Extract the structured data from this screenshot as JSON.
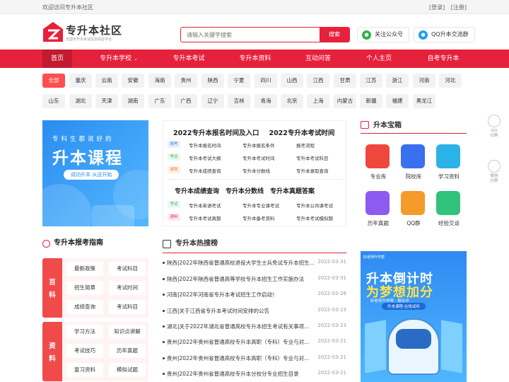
{
  "topbar": {
    "welcome": "欢迎访问专升本社区",
    "login": "[登录]",
    "register": "[注册]"
  },
  "logo": {
    "name": "专升本社区",
    "tagline": "全国专升本考试信息综合平台"
  },
  "search": {
    "placeholder": "请输入关键字搜索",
    "button": "搜索"
  },
  "header_buttons": {
    "wechat": "关注公众号",
    "qq": "QQ升本交流群"
  },
  "nav": [
    "首页",
    "专升本学校",
    "专升本考试",
    "专升本资料",
    "互动问答",
    "个人主页",
    "自考专升本"
  ],
  "regions": [
    [
      "全部",
      "重庆",
      "云南",
      "安徽",
      "海南",
      "贵州",
      "陕西",
      "宁夏",
      "四川",
      "山西",
      "江西",
      "甘肃",
      "江苏",
      "浙江",
      "河南",
      "河北"
    ],
    [
      "山东",
      "湖北",
      "天津",
      "湖南",
      "广东",
      "广西",
      "辽宁",
      "吉林",
      "青海",
      "北京",
      "上海",
      "内蒙古",
      "新疆",
      "福建",
      "黑龙江"
    ]
  ],
  "banner_left": {
    "line1": "专科生都说好的",
    "line2": "升本课程",
    "line3": "成功升本 从这开始"
  },
  "mid": {
    "head1": "2022专升本报名时间及入口",
    "head2": "2022专升本考试时间",
    "rows1": [
      {
        "badge": "报考",
        "cells": [
          "专升本报名时间",
          "专升本报名条件",
          "报考流程"
        ]
      },
      {
        "badge": "考试",
        "cells": [
          "专升本考试大纲",
          "专升本考试时间",
          "专升本考试科目"
        ]
      },
      {
        "badge": "录取",
        "cells": [
          "专升本成绩查询",
          "专升本分数线",
          "专升本录取查询"
        ]
      }
    ],
    "head3": "专升本成绩查询",
    "head4": "专升本分数线",
    "head5": "专升本真题答案",
    "rows2": [
      {
        "badge": "考试",
        "cells": [
          "专升本英语考试",
          "专升本专业课考试",
          "专升本公共课考试"
        ]
      },
      {
        "badge": "资料",
        "cells": [
          "专升本考试真题",
          "专升本备考资料",
          "专升本考试模拟题"
        ]
      }
    ]
  },
  "toolbox": {
    "title": "升本宝箱",
    "items": [
      "专业库",
      "院校库",
      "学习资料",
      "历年真题",
      "QQ群",
      "经验交谈"
    ]
  },
  "guide": {
    "title": "专升本报考指南",
    "side1": [
      "百",
      "科"
    ],
    "side2": [
      "资",
      "料"
    ],
    "group1": [
      "最新政策",
      "考试科目",
      "招生简章",
      "考试时间",
      "成绩查询",
      "考试科目"
    ],
    "group2": [
      "学习方法",
      "知识点讲解",
      "考试技巧",
      "历年真题",
      "复习资料",
      "模拟试题"
    ]
  },
  "hot": {
    "title": "专升本热搜榜",
    "items": [
      {
        "text": "陕西|2022年陕西省普通高校退役大学生士兵免试专升本招生...",
        "date": "2022-03-31"
      },
      {
        "text": "陕西|2022年陕西省普通高等学校专升本招生工作实施办法",
        "date": "2022-03-31"
      },
      {
        "text": "河南|2022年河南省专升本考试招生工作启动！",
        "date": "2022-03-28"
      },
      {
        "text": "江西|关于江西省专升本考试时间安排的公告",
        "date": "2022-03-23"
      },
      {
        "text": "湖北|关于2022年湖北省普通高校专升本招生考试有关事项...",
        "date": "2022-03-23"
      },
      {
        "text": "贵州|2022年贵州省普通高校专升本高职（专科）专业与对...",
        "date": "2022-03-21"
      },
      {
        "text": "贵州|2022年贵州省普通高校专升本高职（专科）专业与对...",
        "date": "2022-03-21"
      },
      {
        "text": "贵州|2022年贵州省普通高校专升本分校分专业招生目录",
        "date": "2022-03-21"
      }
    ]
  },
  "banner_right": {
    "top": "好老师升学帮",
    "line1": "升本倒计时",
    "line2": "为梦想加分",
    "sub": "好老师升学帮 · 报名中",
    "pill": "升本课程·在线试听"
  },
  "float": [
    {
      "label": "QQ\n社群"
    },
    {
      "label": "微信\n社群"
    }
  ]
}
